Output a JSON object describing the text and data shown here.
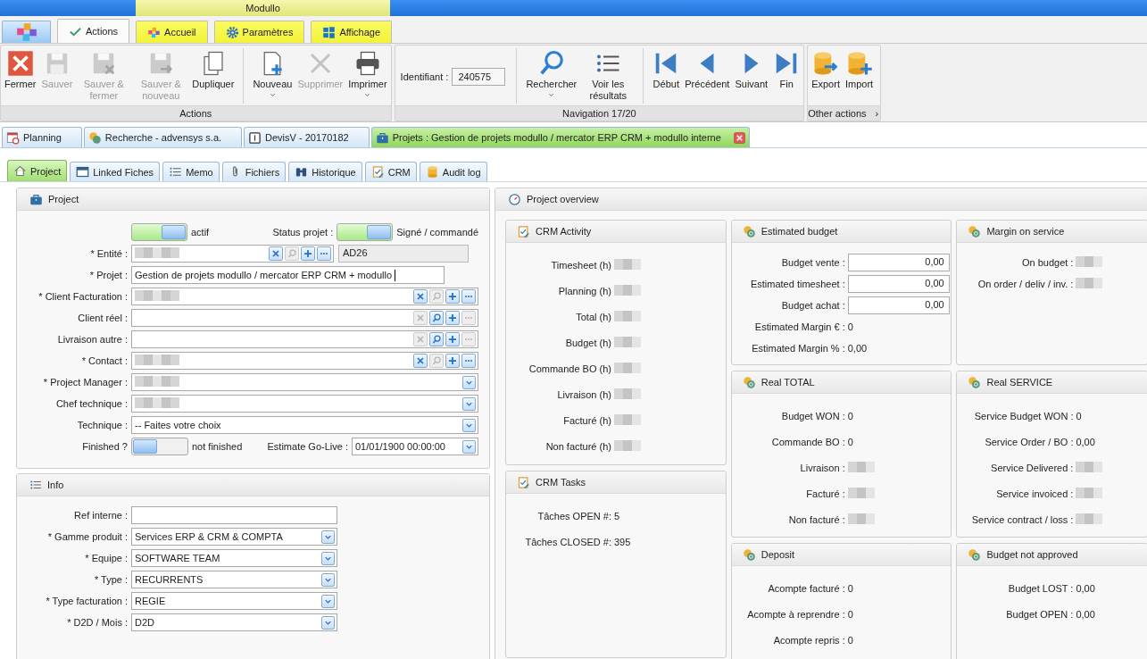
{
  "app_title": "Modullo",
  "ribbon_tabs": [
    {
      "kind": "logo",
      "selected": false
    },
    {
      "kind": "tab",
      "label": "Actions",
      "selected": true
    },
    {
      "kind": "tab",
      "label": "Accueil",
      "selected": false
    },
    {
      "kind": "tab",
      "label": "Paramètres",
      "selected": false
    },
    {
      "kind": "tab",
      "label": "Affichage",
      "selected": false
    }
  ],
  "ribbon_groups": [
    {
      "title": "Actions",
      "items": [
        {
          "kind": "button",
          "label": "Fermer",
          "disabled": false
        },
        {
          "kind": "button",
          "label": "Sauver",
          "disabled": true
        },
        {
          "kind": "button",
          "label": "Sauver & fermer",
          "disabled": true
        },
        {
          "kind": "button",
          "label": "Sauver & nouveau",
          "disabled": true
        },
        {
          "kind": "button",
          "label": "Dupliquer",
          "disabled": false
        },
        {
          "kind": "button",
          "label": "Nouveau",
          "disabled": false,
          "dropdown": true,
          "separator": true
        },
        {
          "kind": "button",
          "label": "Supprimer",
          "disabled": true
        },
        {
          "kind": "button",
          "label": "Imprimer",
          "disabled": false,
          "dropdown": true
        }
      ]
    },
    {
      "title": "Navigation 17/20",
      "items": [
        {
          "kind": "field",
          "label": "Identifiant :",
          "value": "240575"
        },
        {
          "kind": "button",
          "label": "Rechercher",
          "disabled": false,
          "dropdown": true,
          "separator": true
        },
        {
          "kind": "button",
          "label": "Voir les résultats",
          "disabled": false
        },
        {
          "kind": "button",
          "label": "Début",
          "disabled": false,
          "separator": true
        },
        {
          "kind": "button",
          "label": "Précédent",
          "disabled": false
        },
        {
          "kind": "button",
          "label": "Suivant",
          "disabled": false
        },
        {
          "kind": "button",
          "label": "Fin",
          "disabled": false
        }
      ]
    },
    {
      "title": "Other actions",
      "launcher": "›",
      "items": [
        {
          "kind": "button",
          "label": "Export",
          "disabled": false
        },
        {
          "kind": "button",
          "label": "Import",
          "disabled": false
        }
      ]
    }
  ],
  "document_tabs": [
    {
      "label": "Planning",
      "selected": false
    },
    {
      "label": "Recherche - advensys s.a.",
      "selected": false
    },
    {
      "label": "DevisV - 20170182",
      "selected": false
    },
    {
      "label": "Projets : Gestion de projets modullo / mercator ERP CRM + modullo interne",
      "selected": true,
      "closable": true
    }
  ],
  "sub_tabs": [
    {
      "label": "Project",
      "selected": true
    },
    {
      "label": "Linked Fiches",
      "selected": false
    },
    {
      "label": "Memo",
      "selected": false
    },
    {
      "label": "Fichiers",
      "selected": false
    },
    {
      "label": "Historique",
      "selected": false
    },
    {
      "label": "CRM",
      "selected": false
    },
    {
      "label": "Audit log",
      "selected": false
    }
  ],
  "project": {
    "title": "Project",
    "active": {
      "on": true,
      "text": "actif"
    },
    "status": {
      "label": "Status projet :",
      "on": true,
      "text": "Signé / commandé"
    },
    "fields": [
      {
        "kind": "lookup",
        "label": "* Entité :",
        "blurred": true,
        "code": "AD26",
        "actions": [
          {
            "kind": "clear",
            "disabled": false
          },
          {
            "kind": "search",
            "disabled": true
          },
          {
            "kind": "add",
            "disabled": false
          },
          {
            "kind": "more",
            "disabled": false
          }
        ]
      },
      {
        "kind": "text",
        "label": "* Projet :",
        "value": "Gestion de projets modullo / mercator ERP CRM + modullo",
        "focused": true
      },
      {
        "kind": "lookup",
        "label": "* Client Facturation :",
        "blurred": true,
        "actions": [
          {
            "kind": "clear",
            "disabled": false
          },
          {
            "kind": "search",
            "disabled": true
          },
          {
            "kind": "add",
            "disabled": false
          },
          {
            "kind": "more",
            "disabled": false
          }
        ]
      },
      {
        "kind": "lookup",
        "label": "Client réel :",
        "actions": [
          {
            "kind": "clear",
            "disabled": true
          },
          {
            "kind": "search",
            "disabled": false
          },
          {
            "kind": "add",
            "disabled": false
          },
          {
            "kind": "more",
            "disabled": true
          }
        ]
      },
      {
        "kind": "lookup",
        "label": "Livraison autre :",
        "actions": [
          {
            "kind": "clear",
            "disabled": true
          },
          {
            "kind": "search",
            "disabled": false
          },
          {
            "kind": "add",
            "disabled": false
          },
          {
            "kind": "more",
            "disabled": true
          }
        ]
      },
      {
        "kind": "lookup",
        "label": "* Contact :",
        "blurred": true,
        "actions": [
          {
            "kind": "clear",
            "disabled": false
          },
          {
            "kind": "search",
            "disabled": true
          },
          {
            "kind": "add",
            "disabled": false
          },
          {
            "kind": "more",
            "disabled": false
          }
        ]
      },
      {
        "kind": "select",
        "label": "* Project Manager :",
        "blurred": true
      },
      {
        "kind": "select",
        "label": "Chef technique :",
        "blurred": true
      },
      {
        "kind": "select",
        "label": "Technique :",
        "value": "-- Faites votre choix"
      }
    ],
    "finished": {
      "label": "Finished ?",
      "on": false,
      "text": "not finished"
    },
    "go_live": {
      "label": "Estimate Go-Live :",
      "value": "01/01/1900 00:00:00"
    }
  },
  "info": {
    "title": "Info",
    "fields": [
      {
        "kind": "text",
        "label": "Ref interne :"
      },
      {
        "kind": "select",
        "label": "* Gamme produit :",
        "value": "Services ERP & CRM & COMPTA"
      },
      {
        "kind": "select",
        "label": "* Equipe :",
        "value": "SOFTWARE TEAM"
      },
      {
        "kind": "select",
        "label": "* Type :",
        "value": "RECURRENTS"
      },
      {
        "kind": "select",
        "label": "* Type facturation :",
        "value": "REGIE"
      },
      {
        "kind": "select",
        "label": "* D2D / Mois :",
        "value": "D2D"
      }
    ]
  },
  "overview": {
    "title": "Project overview",
    "columns": [
      [
        {
          "kind": "tasks",
          "title": "CRM Activity",
          "rows": [
            {
              "label": "Timesheet (h)",
              "blurred": true
            },
            {
              "label": "Planning (h)",
              "blurred": true
            },
            {
              "label": "Total (h)",
              "blurred": true
            },
            {
              "label": "Budget (h)",
              "blurred": true
            },
            {
              "label": "Commande BO (h)",
              "blurred": true
            },
            {
              "label": "Livraison (h)",
              "blurred": true
            },
            {
              "label": "Facturé (h)",
              "blurred": true
            },
            {
              "label": "Non facturé (h)",
              "blurred": true
            }
          ]
        },
        {
          "kind": "tasks",
          "title": "CRM Tasks",
          "rows": [
            {
              "label": "Tâches OPEN #:",
              "value": "5"
            },
            {
              "label": "Tâches CLOSED #:",
              "value": "395"
            }
          ]
        }
      ],
      [
        {
          "kind": "money",
          "title": "Estimated budget",
          "rows": [
            {
              "kind": "input",
              "label": "Budget vente :",
              "value": "0,00"
            },
            {
              "kind": "input",
              "label": "Estimated timesheet :",
              "value": "0,00"
            },
            {
              "kind": "input",
              "label": "Budget achat :",
              "value": "0,00"
            },
            {
              "label": "Estimated Margin € :",
              "value": "0"
            },
            {
              "label": "Estimated Margin % :",
              "value": "0,00"
            }
          ]
        },
        {
          "kind": "money",
          "title": "Real TOTAL",
          "rows": [
            {
              "label": "Budget WON :",
              "value": "0"
            },
            {
              "label": "Commande BO :",
              "value": "0"
            },
            {
              "label": "Livraison :",
              "blurred": true
            },
            {
              "label": "Facturé :",
              "blurred": true
            },
            {
              "label": "Non facturé :",
              "blurred": true
            }
          ]
        },
        {
          "kind": "money",
          "title": "Deposit",
          "rows": [
            {
              "label": "Acompte facturé :",
              "value": "0"
            },
            {
              "label": "Acompte à reprendre :",
              "value": "0"
            },
            {
              "label": "Acompte repris :",
              "value": "0"
            }
          ]
        }
      ],
      [
        {
          "kind": "money",
          "title": "Margin on service",
          "rows": [
            {
              "kind": "input-free",
              "label": "On budget :",
              "blurred": true
            },
            {
              "kind": "input-free",
              "label": "On order / deliv / inv.  :",
              "blurred": true
            }
          ]
        },
        {
          "kind": "money",
          "title": "Real SERVICE",
          "rows": [
            {
              "label": "Service Budget WON :",
              "value": "0"
            },
            {
              "label": "Service Order / BO :",
              "value": "0,00"
            },
            {
              "label": "Service Delivered :",
              "blurred": true
            },
            {
              "label": "Service invoiced :",
              "blurred": true
            },
            {
              "label": "Service contract / loss :",
              "blurred": true
            }
          ]
        },
        {
          "kind": "money",
          "title": "Budget not approved",
          "rows": [
            {
              "label": "Budget LOST :",
              "value": "0,00"
            },
            {
              "label": "Budget OPEN :",
              "value": "0,00"
            }
          ]
        }
      ]
    ]
  }
}
